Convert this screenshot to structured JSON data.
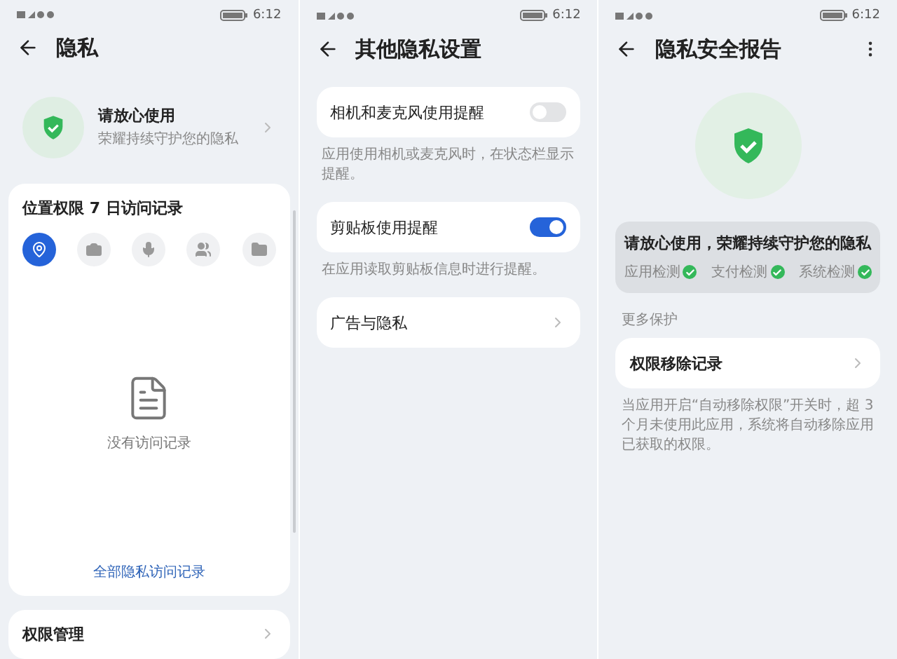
{
  "screens": [
    {
      "kind": "privacy",
      "time": "6:12",
      "title": "隐私",
      "banner": {
        "title": "请放心使用",
        "subtitle": "荣耀持续守护您的隐私"
      },
      "records": {
        "title": "位置权限 7 日访问记录",
        "tabs": [
          {
            "kind": "location",
            "selected": true
          },
          {
            "kind": "camera",
            "selected": false
          },
          {
            "kind": "microphone",
            "selected": false
          },
          {
            "kind": "contacts",
            "selected": false
          },
          {
            "kind": "folder",
            "selected": false
          }
        ],
        "empty": "没有访问记录",
        "link": "全部隐私访问记录"
      },
      "menu": [
        {
          "label": "权限管理"
        }
      ]
    },
    {
      "kind": "settings",
      "time": "6:12",
      "title": "其他隐私设置",
      "items": [
        {
          "kind": "toggle",
          "label": "相机和麦克风使用提醒",
          "on": false,
          "note": "应用使用相机或麦克风时，在状态栏显示提醒。"
        },
        {
          "kind": "toggle",
          "label": "剪贴板使用提醒",
          "on": true,
          "note": "在应用读取剪贴板信息时进行提醒。"
        },
        {
          "kind": "link",
          "label": "广告与隐私"
        }
      ]
    },
    {
      "kind": "report",
      "time": "6:12",
      "title": "隐私安全报告",
      "summary": {
        "title": "请放心使用，荣耀持续守护您的隐私",
        "checks": [
          {
            "label": "应用检测",
            "passed": true
          },
          {
            "label": "支付检测",
            "passed": true
          },
          {
            "label": "系统检测",
            "passed": true
          }
        ]
      },
      "section": "更多保护",
      "item": "权限移除记录",
      "note": "当应用开启“自动移除权限”开关时，超 3 个月未使用此应用，系统将自动移除应用已获取的权限。"
    }
  ]
}
